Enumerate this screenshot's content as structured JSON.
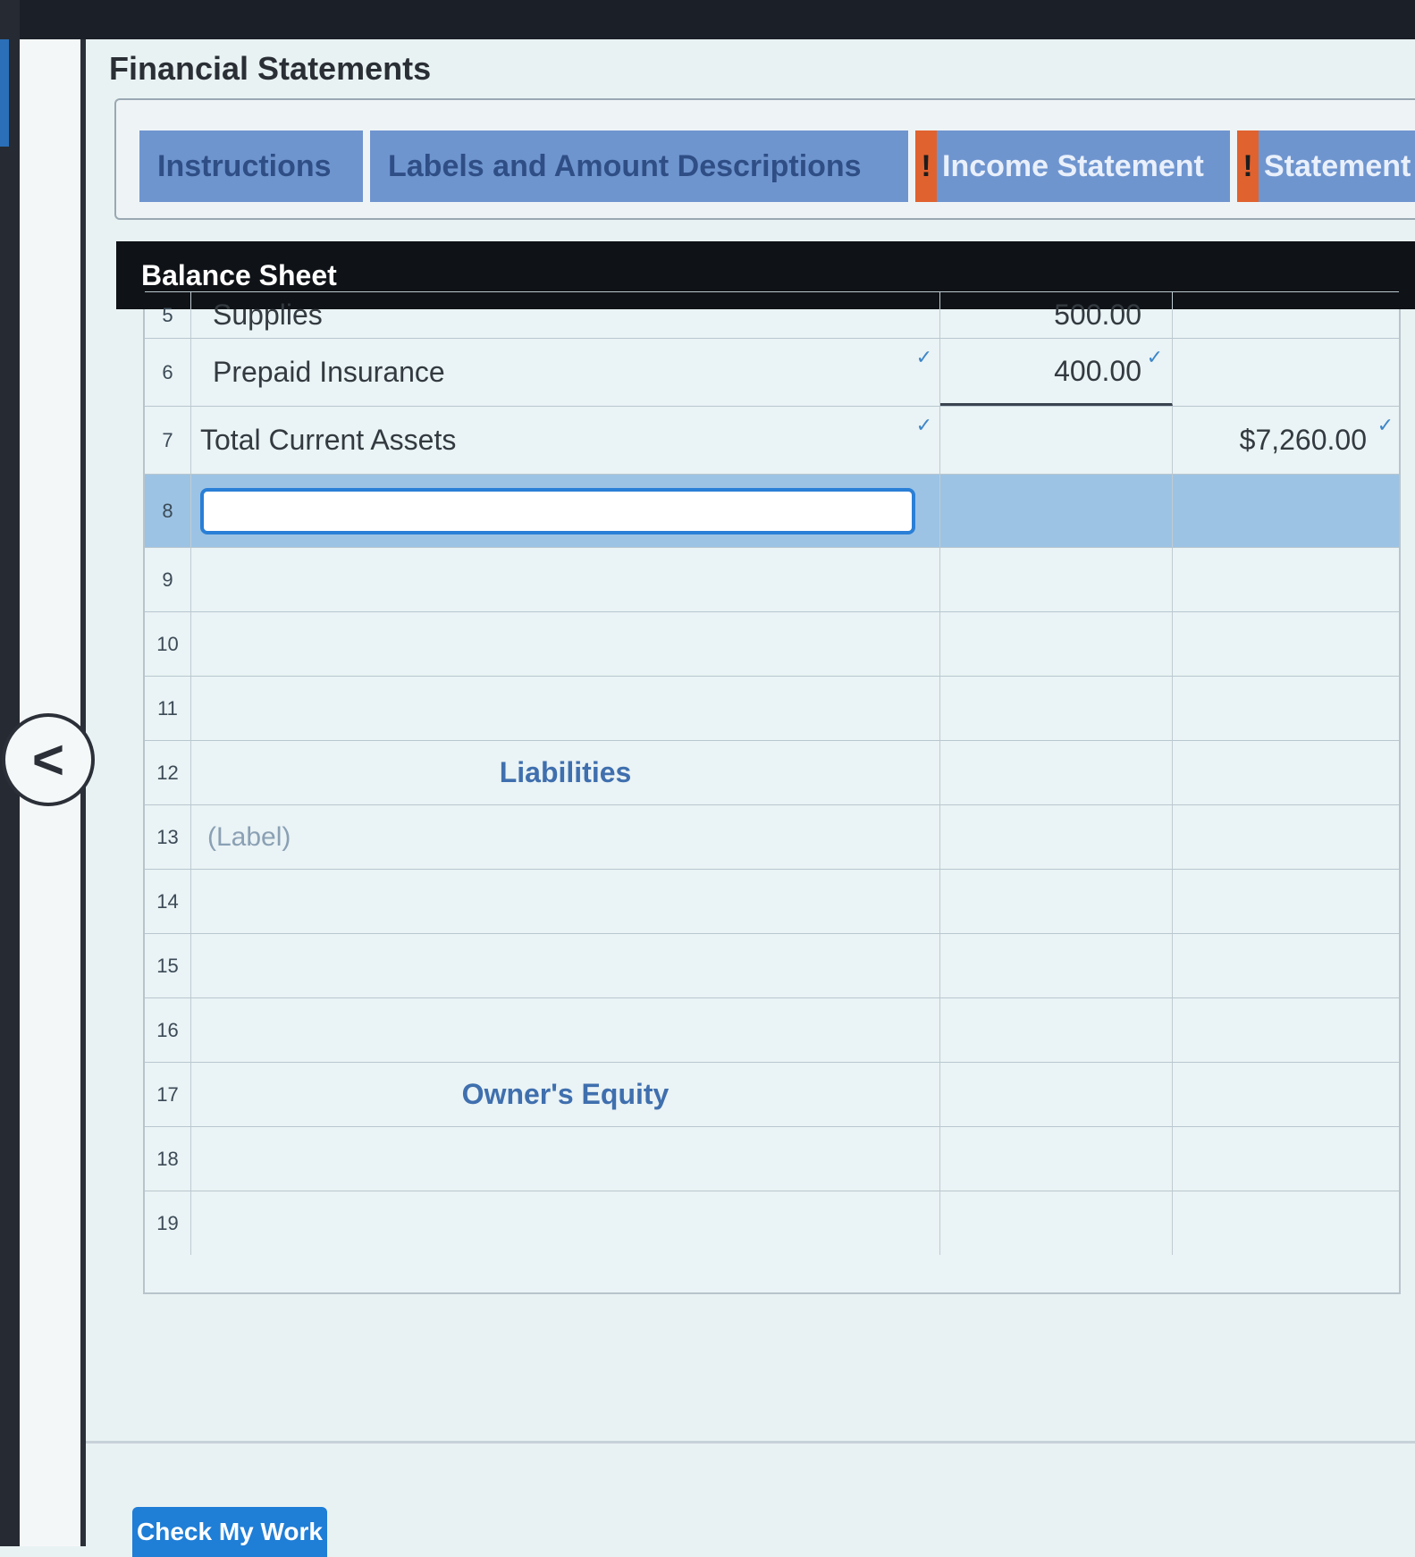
{
  "page": {
    "title": "Financial Statements"
  },
  "tabs": [
    {
      "label": "Instructions",
      "warning": false
    },
    {
      "label": "Labels and Amount Descriptions",
      "warning": false
    },
    {
      "label": "Income Statement",
      "warning": true,
      "warning_mark": "!"
    },
    {
      "label": "Statement",
      "warning": true,
      "warning_mark": "!"
    }
  ],
  "balance_sheet": {
    "header": "Balance Sheet",
    "check_mark": "✓",
    "rows": [
      {
        "num": "5",
        "description": "Supplies",
        "amount1": "500.00",
        "amount2": ""
      },
      {
        "num": "6",
        "description": "Prepaid Insurance",
        "amount1": "400.00",
        "amount2": ""
      },
      {
        "num": "7",
        "description": "Total Current Assets",
        "amount1": "",
        "amount2": "$7,260.00"
      },
      {
        "num": "8",
        "description": "",
        "amount1": "",
        "amount2": ""
      },
      {
        "num": "9",
        "description": "",
        "amount1": "",
        "amount2": ""
      },
      {
        "num": "10",
        "description": "",
        "amount1": "",
        "amount2": ""
      },
      {
        "num": "11",
        "description": "",
        "amount1": "",
        "amount2": ""
      },
      {
        "num": "12",
        "description": "Liabilities",
        "amount1": "",
        "amount2": ""
      },
      {
        "num": "13",
        "description": "(Label)",
        "amount1": "",
        "amount2": ""
      },
      {
        "num": "14",
        "description": "",
        "amount1": "",
        "amount2": ""
      },
      {
        "num": "15",
        "description": "",
        "amount1": "",
        "amount2": ""
      },
      {
        "num": "16",
        "description": "",
        "amount1": "",
        "amount2": ""
      },
      {
        "num": "17",
        "description": "Owner's Equity",
        "amount1": "",
        "amount2": ""
      },
      {
        "num": "18",
        "description": "",
        "amount1": "",
        "amount2": ""
      },
      {
        "num": "19",
        "description": "",
        "amount1": "",
        "amount2": ""
      }
    ]
  },
  "nav": {
    "back_icon": "chevron-left-icon",
    "back_glyph": "<"
  },
  "actions": {
    "check_my_work": "Check My Work"
  },
  "colors": {
    "tab_bg": "#6f95cf",
    "warning": "#e0622f",
    "header_bg": "#0f1216",
    "active_row": "#9cc3e4",
    "input_border": "#2a7fd6",
    "button": "#1f7ed6"
  }
}
